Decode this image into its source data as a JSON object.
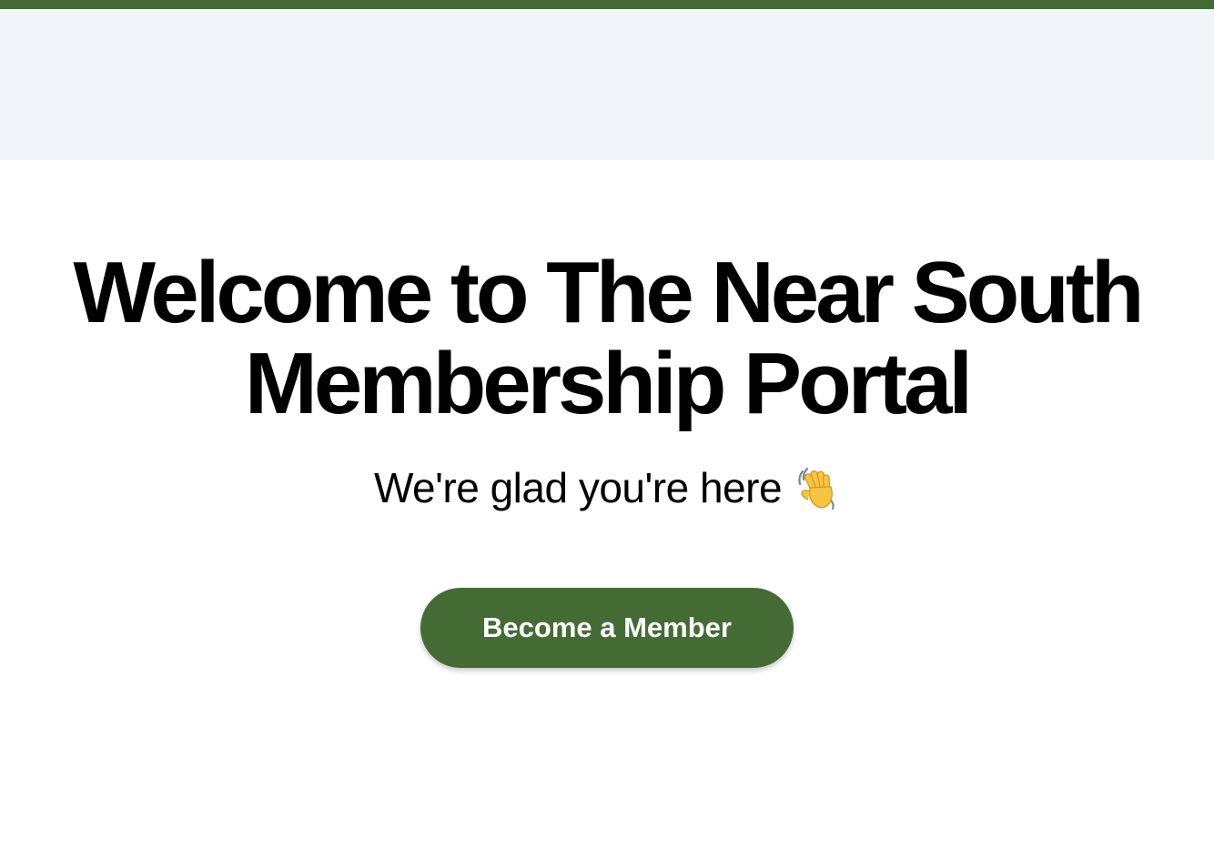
{
  "hero": {
    "title": "Welcome to The Near South Membership Portal",
    "subtitle": "We're glad you're here",
    "subtitle_icon": "waving-hand-icon"
  },
  "cta": {
    "label": "Become a Member"
  },
  "colors": {
    "brand_green": "#446b34",
    "header_band": "#f1f5f9",
    "background": "#ffffff",
    "text": "#000000",
    "button_text": "#ffffff"
  }
}
